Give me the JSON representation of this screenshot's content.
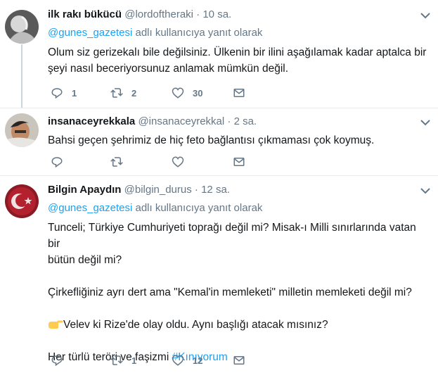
{
  "tweets": [
    {
      "name": "ilk rakı bükücü",
      "handle": "@lordoftheraki",
      "time": "10 sa.",
      "reply_prefix": "",
      "reply_mention": "@gunes_gazetesi",
      "reply_suffix": " adlı kullanıcıya yanıt olarak",
      "lines": [
        "Olum siz gerizekalı bile değilsiniz. Ülkenin bir ilini aşağılamak kadar aptalca bir",
        "şeyi nasıl beceriyorsunuz anlamak mümkün değil."
      ],
      "replies": "1",
      "retweets": "2",
      "likes": "30"
    },
    {
      "name": "insanaceyrekkala",
      "handle": "@insanaceyrekkal",
      "time": "2 sa.",
      "lines": [
        "Bahsi geçen şehrimiz de hiç feto bağlantısı çıkmaması çok koymuş."
      ],
      "replies": "",
      "retweets": "",
      "likes": ""
    },
    {
      "name": "Bilgin Apaydın",
      "handle": "@bilgin_durus",
      "time": "12 sa.",
      "reply_mention": "@gunes_gazetesi",
      "reply_suffix": " adlı kullanıcıya yanıt olarak",
      "paragraphs": [
        "Tunceli; Türkiye Cumhuriyeti toprağı değil mi? Misak-ı Milli sınırlarında vatan bir",
        "bütün değil mi?",
        "Çirkefliğiniz ayrı dert ama \"Kemal'in memleketi\" milletin memleketi değil mi?",
        "Velev ki Rize'de olay oldu. Aynı başlığı atacak mısınız?",
        "Her türlü teröri ve faşizmi ",
        "#Kınıyorum"
      ],
      "replies": "",
      "retweets": "1",
      "likes": "12"
    }
  ],
  "separator": "·",
  "colors": {
    "accent": "#1da1f2",
    "muted": "#657786",
    "text": "#14171a",
    "border": "#e6ecf0"
  },
  "icons": [
    "reply-icon",
    "retweet-icon",
    "like-icon",
    "dm-icon",
    "chevron-down-icon",
    "pointing-hand-icon"
  ]
}
